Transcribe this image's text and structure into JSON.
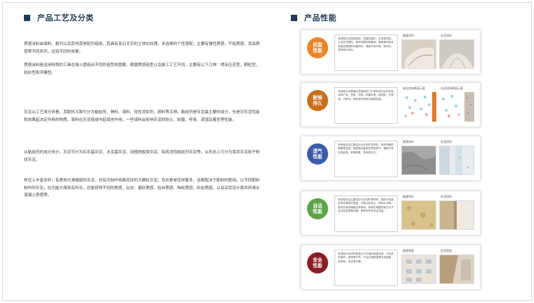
{
  "left": {
    "heading": "产品工艺及分类",
    "paragraphs": [
      "质感涂料由填料、黏剂以及其他其他助剂组成。其具有变幻无穷的立体化纹理，多选择的个性搭配，主要有弹性质感、干粘质感、泼采质感等不同系列，达到不同的效果。",
      "质感涂料是运用特殊的工具在墙上塑造出不同的造型和图案，根据质感造型以及施工工艺不同，主要有以下几种：喷涂压花型，颗粒型，刮砂型和浮雕型。",
      "灰泥从工艺成分来看，其配料大致可分为黏结剂、骨料、填料、改性添加剂、颜料等五种。黏结剂是灰泥最主要的成分，也是对灰泥性能和效果起决定作用的物质。填料在灰泥组成中起填充作用，一些填料会影响灰泥的耐火、耐磨、呼吸、调湿及着色等性能。",
      "从黏结剂的成分来分，灰泥可分为石灰基灰泥、水泥基灰泥、动植物胶类灰泥、有机改性黏结剂灰泥等。从形态上可分为浆状灰泥和干粉状灰泥。",
      "样式上丰富多样，有质地光滑细腻的灰泥，也有可制作饰面花纹的大颗粒灰泥；色彩更是花样繁多，这都取决于配料的配用。以不同配料制作的灰泥，在功能方面各有所长，还能获得不同的质感，比如：磨砂质感、粒丝质感、陶纹质感、砂岩质感，以及深受设计喜欢的清水混凝土质感等。"
    ]
  },
  "right": {
    "heading": "产品性能",
    "cards": [
      {
        "badge": "抗裂性能",
        "color": "#e8862a",
        "desc": "采用吸灰泥的质感性，抗裂性能好，灰泥类材料，以及抗开裂性，具有特殊的微膨胀，是做墙体装饰表面较理想的可靠材料，墙面不易开裂，耐风化，寿命较长持久。",
        "label_a": "普通涂料",
        "label_b": "灰泥材料"
      },
      {
        "badge": "耐候持久",
        "color": "#c9701a",
        "desc": "采用吸灰泥是通过混凝或砖门户墙体测试比的铁色涂料产品，亮泽，抗紫，耐磨外表，粘贴贴，不掉落，不粉化，具有良好的耐久耐候性能。",
        "label_a": "有机涂料断面示意",
        "label_b": "灰泥材料断面示意"
      },
      {
        "badge": "透气性能",
        "color": "#3b5ba8",
        "desc": "采用吸灰泥主要成分为无机矿物材料，具有特殊的微膨胀结构，能够保持墙体的呼吸透气，墙面不易出现起泡、剥落现象，寿命更长久。",
        "label_a": "普通涂料",
        "label_b": "灰泥材料"
      },
      {
        "badge": "自洁性能",
        "color": "#5fa24a",
        "desc": "采用吸灰泥主要成分为无机矿物材料，其防污性能优异自带耐污性能，不易沾染灰尘，耐雨水冲刷，能持久保持墙面洁净美观，即使在潮湿的南方也不会出现发霉等问题，具有较好的自洁功能。",
        "label_a": "普通涂料",
        "label_b": "灰泥材料"
      },
      {
        "badge": "安全性能",
        "color": "#8b1e24",
        "desc": "采用吸灰泥材料是适合于外墙外保温系统，与传统的建材，瓷砖等不同，不会出现脱落等安全隐患，质量轻，安全更可靠。",
        "label_a": "普通墙面",
        "label_b": "灰泥墙面"
      }
    ]
  }
}
